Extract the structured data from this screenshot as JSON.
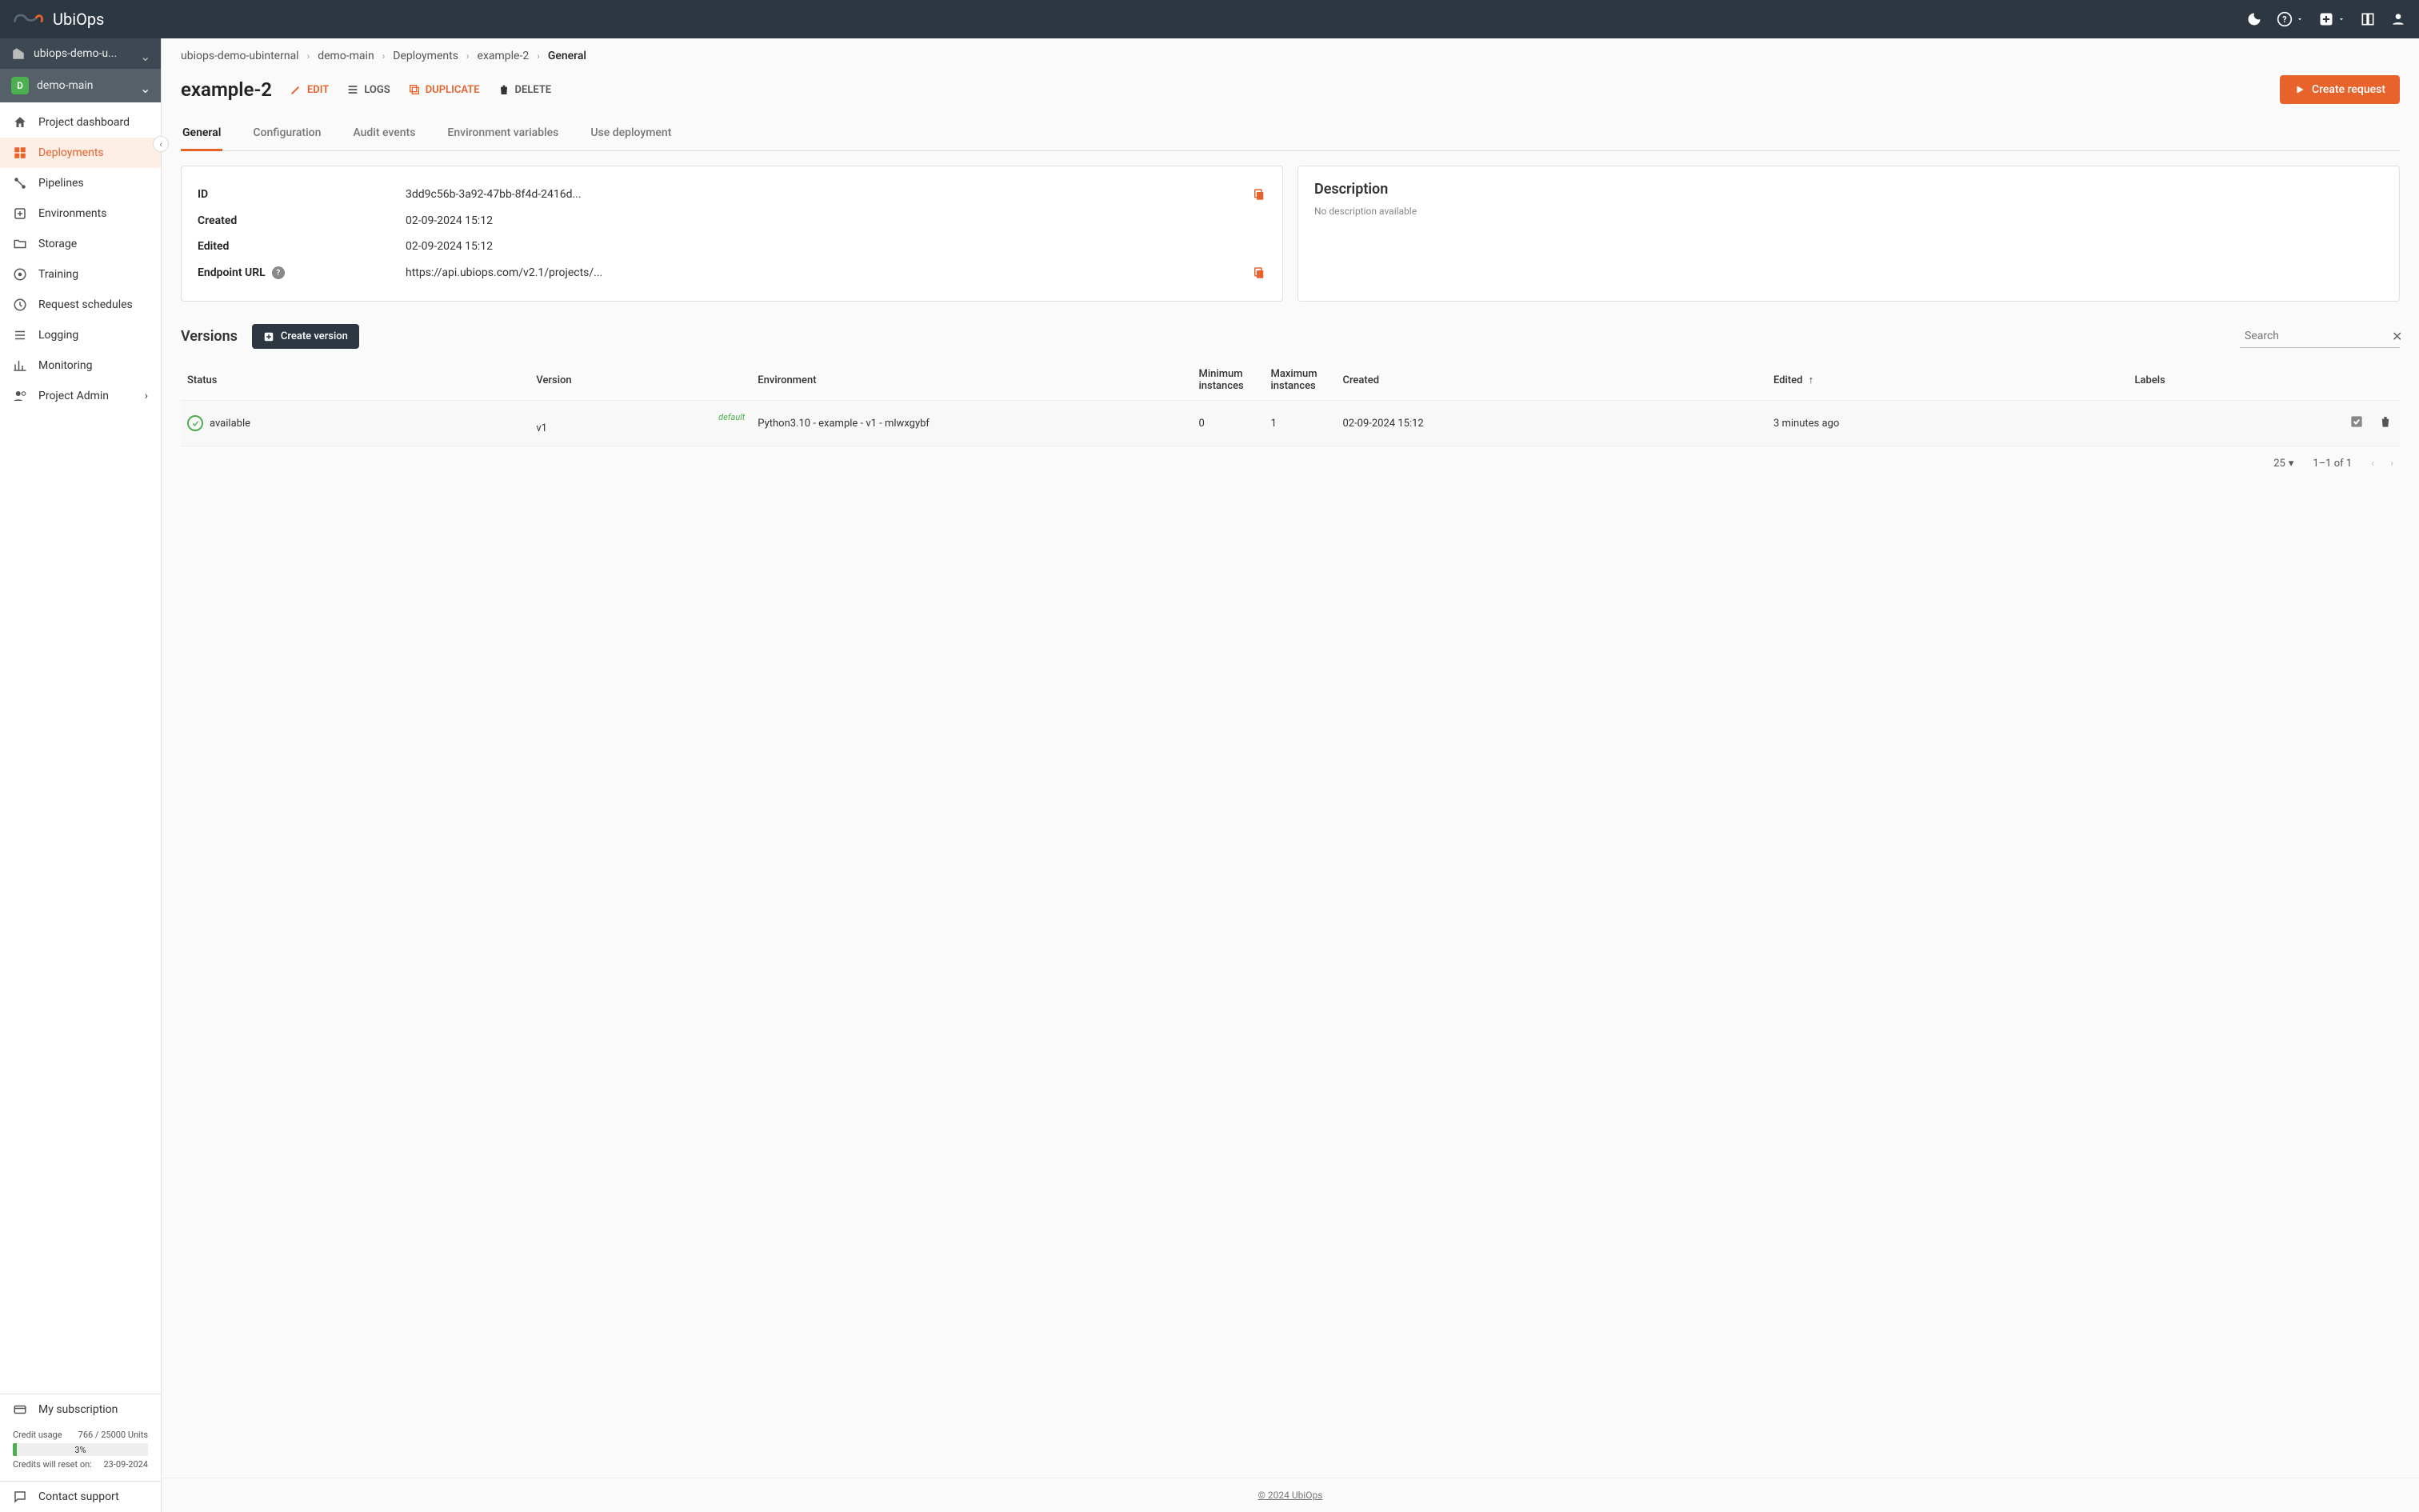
{
  "brand": "UbiOps",
  "sidebar": {
    "org": "ubiops-demo-u...",
    "project": "demo-main",
    "project_badge": "D",
    "items": [
      {
        "label": "Project dashboard"
      },
      {
        "label": "Deployments"
      },
      {
        "label": "Pipelines"
      },
      {
        "label": "Environments"
      },
      {
        "label": "Storage"
      },
      {
        "label": "Training"
      },
      {
        "label": "Request schedules"
      },
      {
        "label": "Logging"
      },
      {
        "label": "Monitoring"
      },
      {
        "label": "Project Admin"
      }
    ],
    "subscription_label": "My subscription",
    "credit_usage_label": "Credit usage",
    "credit_usage_value": "766 / 25000 Units",
    "credit_pct": "3%",
    "reset_label": "Credits will reset on:",
    "reset_date": "23-09-2024",
    "contact_label": "Contact support"
  },
  "breadcrumb": {
    "items": [
      "ubiops-demo-ubinternal",
      "demo-main",
      "Deployments",
      "example-2",
      "General"
    ]
  },
  "page": {
    "title": "example-2",
    "actions": {
      "edit": "EDIT",
      "logs": "LOGS",
      "duplicate": "DUPLICATE",
      "delete": "DELETE"
    },
    "create_request": "Create request"
  },
  "tabs": [
    "General",
    "Configuration",
    "Audit events",
    "Environment variables",
    "Use deployment"
  ],
  "info": {
    "id_label": "ID",
    "id_value": "3dd9c56b-3a92-47bb-8f4d-2416d...",
    "created_label": "Created",
    "created_value": "02-09-2024 15:12",
    "edited_label": "Edited",
    "edited_value": "02-09-2024 15:12",
    "endpoint_label": "Endpoint URL",
    "endpoint_value": "https://api.ubiops.com/v2.1/projects/..."
  },
  "description": {
    "title": "Description",
    "text": "No description available"
  },
  "versions": {
    "title": "Versions",
    "create_label": "Create version",
    "search_placeholder": "Search",
    "columns": {
      "status": "Status",
      "version": "Version",
      "environment": "Environment",
      "min": "Minimum instances",
      "max": "Maximum instances",
      "created": "Created",
      "edited": "Edited",
      "labels": "Labels"
    },
    "rows": [
      {
        "status": "available",
        "default_tag": "default",
        "version": "v1",
        "environment": "Python3.10 - example - v1 - mlwxgybf",
        "min": "0",
        "max": "1",
        "created": "02-09-2024 15:12",
        "edited": "3 minutes ago",
        "labels": ""
      }
    ],
    "page_size": "25",
    "page_range": "1–1 of 1"
  },
  "footer": "© 2024 UbiOps"
}
